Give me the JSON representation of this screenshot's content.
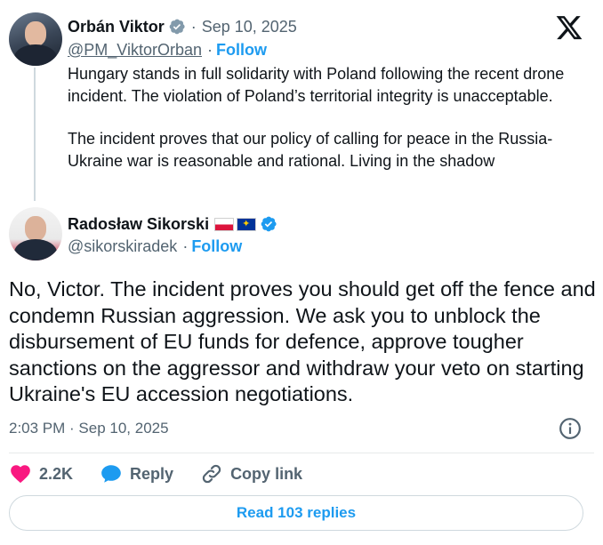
{
  "parent_tweet": {
    "author_name": "Orbán Viktor",
    "separator": "·",
    "date": "Sep 10, 2025",
    "handle": "@PM_ViktorOrban",
    "follow_label": "Follow",
    "paragraphs": [
      "Hungary stands in full solidarity with Poland following the recent drone incident. The violation of Poland’s territorial integrity is unacceptable.",
      "The incident proves that our policy of calling for peace in the Russia-Ukraine war is reasonable and rational. Living in the shadow"
    ]
  },
  "reply_tweet": {
    "author_name": "Radosław Sikorski",
    "handle": "@sikorskiradek",
    "separator": "·",
    "follow_label": "Follow",
    "text": "No, Victor.  The incident proves you should get off the fence and condemn Russian aggression.  We ask you to unblock the disbursement of EU funds for defence, approve tougher sanctions on the aggressor and withdraw your veto on starting Ukraine's EU accession negotiations.",
    "timestamp": "2:03 PM · Sep 10, 2025"
  },
  "actions": {
    "like_count": "2.2K",
    "reply_label": "Reply",
    "copy_link_label": "Copy link"
  },
  "read_replies_label": "Read 103 replies",
  "icons": {
    "brand": "x-logo-icon",
    "verified": "verified-badge-icon",
    "info": "info-icon",
    "like": "heart-icon",
    "reply": "speech-bubble-icon",
    "copy": "link-icon"
  },
  "colors": {
    "accent": "#1d9bf0",
    "like": "#f91880",
    "muted": "#536471",
    "text": "#0f1419"
  }
}
